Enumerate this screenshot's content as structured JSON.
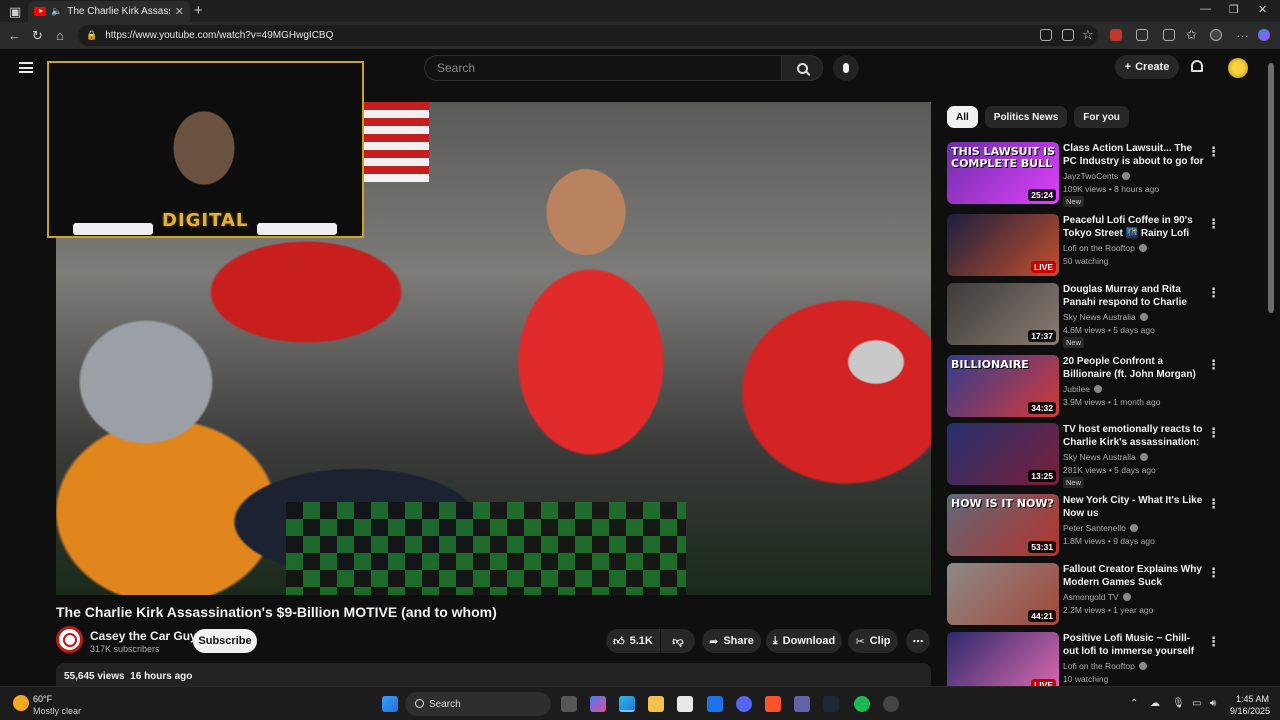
{
  "browser": {
    "tab_title": "The Charlie Kirk Assassinatio",
    "url": "https://www.youtube.com/watch?v=49MGHwgICBQ"
  },
  "youtube": {
    "search_placeholder": "Search",
    "create_label": "Create"
  },
  "webcam": {
    "logo_text": "DIGITAL"
  },
  "video": {
    "title": "The Charlie Kirk Assassination's $9-Billion MOTIVE (and to whom)",
    "channel_name": "Casey the Car Guy",
    "subscribers": "317K subscribers",
    "subscribe_label": "Subscribe",
    "likes": "5.1K",
    "share_label": "Share",
    "download_label": "Download",
    "clip_label": "Clip",
    "views_and_date": "55,645 views  16 hours ago"
  },
  "sidebar": {
    "chips": [
      "All",
      "Politics News",
      "For you"
    ],
    "recommendations": [
      {
        "title": "Class Action Lawsuit... The PC Industry is about to go for a ...",
        "channel": "JayzTwoCents",
        "meta": "109K views • 8 hours ago",
        "badge": "New",
        "duration": "25:24",
        "thumb_text": "THIS LAWSUIT IS COMPLETE BULL",
        "colors": [
          "#6b2fa8",
          "#e040fb"
        ]
      },
      {
        "title": "Peaceful Lofi Coffee in 90's Tokyo Street 🌃 Rainy Lofi Hip...",
        "channel": "Lofi on the Rooftop",
        "meta": "50 watching",
        "badge": "",
        "duration": "",
        "live": "LIVE",
        "thumb_text": "",
        "colors": [
          "#1a1f3d",
          "#c2502e"
        ]
      },
      {
        "title": "Douglas Murray and Rita Panahi respond to Charlie Kirk ...",
        "channel": "Sky News Australia",
        "meta": "4.6M views • 5 days ago",
        "badge": "New",
        "duration": "17:37",
        "thumb_text": "",
        "colors": [
          "#3c3a3a",
          "#8a7d72"
        ]
      },
      {
        "title": "20 People Confront a Billionaire (ft. John Morgan)",
        "channel": "Jubilee",
        "meta": "3.9M views • 1 month ago",
        "badge": "",
        "duration": "34:32",
        "thumb_text": "BILLIONAIRE",
        "colors": [
          "#2e3d8f",
          "#d63a3a"
        ]
      },
      {
        "title": "TV host emotionally reacts to Charlie Kirk's assassination: ...",
        "channel": "Sky News Australia",
        "meta": "281K views • 5 days ago",
        "badge": "New",
        "duration": "13:25",
        "thumb_text": "",
        "colors": [
          "#24306e",
          "#7a1f3a"
        ]
      },
      {
        "title": "New York City - What It's Like Now us",
        "channel": "Peter Santenello",
        "meta": "1.8M views • 9 days ago",
        "badge": "",
        "duration": "53:31",
        "thumb_text": "HOW IS IT NOW?",
        "colors": [
          "#5d6a7a",
          "#b7332b"
        ]
      },
      {
        "title": "Fallout Creator Explains Why Modern Games Suck",
        "channel": "Asmongold TV",
        "meta": "2.2M views • 1 year ago",
        "badge": "",
        "duration": "44:21",
        "thumb_text": "",
        "colors": [
          "#8c8a86",
          "#a3473a"
        ]
      },
      {
        "title": "Positive Lofi Music ~ Chill-out lofi to immerse yourself in a ...",
        "channel": "Lofi on the Rooftop",
        "meta": "10 watching",
        "badge": "",
        "duration": "",
        "live": "LIVE",
        "thumb_text": "",
        "colors": [
          "#2b2a6b",
          "#e06ab0"
        ]
      }
    ]
  },
  "taskbar": {
    "weather_temp": "60°F",
    "weather_desc": "Mostly clear",
    "search_placeholder": "Search",
    "time": "1:45 AM",
    "date": "9/16/2025"
  }
}
